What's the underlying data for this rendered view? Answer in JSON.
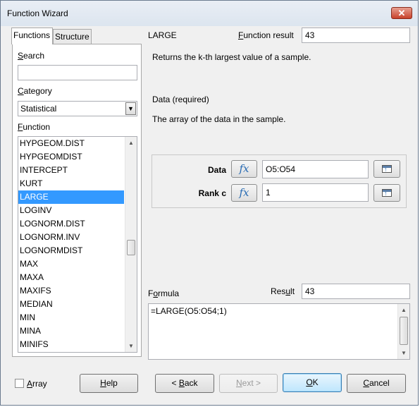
{
  "window": {
    "title": "Function Wizard",
    "close_glyph": "✕"
  },
  "tabs": [
    {
      "label": "Functions",
      "active": true
    },
    {
      "label": "Structure",
      "active": false
    }
  ],
  "left": {
    "search_label": "Search",
    "search_value": "",
    "category_label": "Category",
    "category_value": "Statistical",
    "function_label": "Function",
    "functions": [
      "HYPGEOM.DIST",
      "HYPGEOMDIST",
      "INTERCEPT",
      "KURT",
      "LARGE",
      "LOGINV",
      "LOGNORM.DIST",
      "LOGNORM.INV",
      "LOGNORMDIST",
      "MAX",
      "MAXA",
      "MAXIFS",
      "MEDIAN",
      "MIN",
      "MINA",
      "MINIFS"
    ],
    "selected_function": "LARGE"
  },
  "right": {
    "function_name": "LARGE",
    "function_result_label": "Function result",
    "function_result_value": "43",
    "description": "Returns the k-th largest value of a sample.",
    "param_heading": "Data (required)",
    "param_description": "The array of the data in the sample.",
    "args": [
      {
        "name": "Data",
        "value": "O5:O54"
      },
      {
        "name": "Rank c",
        "value": "1"
      }
    ],
    "fx_glyph": "fx",
    "formula_label": "Formula",
    "result_label": "Result",
    "result_value": "43",
    "formula_value": "=LARGE(O5:O54;1)"
  },
  "footer": {
    "array_label": "Array",
    "help_label": "Help",
    "back_label": "< Back",
    "next_label": "Next >",
    "ok_label": "OK",
    "cancel_label": "Cancel"
  }
}
